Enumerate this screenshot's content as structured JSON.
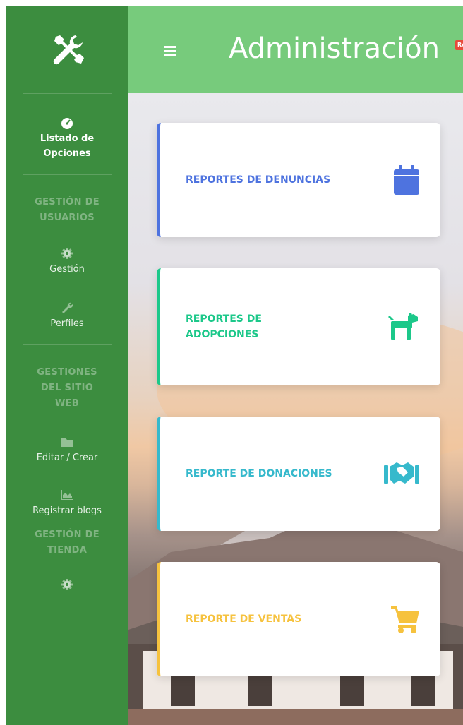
{
  "header": {
    "title": "Administración",
    "badge": "Rep"
  },
  "sidebar": {
    "items": [
      {
        "type": "item",
        "label_line1": "Listado de",
        "label_line2": "Opciones",
        "icon": "tachometer-icon",
        "active": true
      },
      {
        "type": "section",
        "line1": "GESTIÓN DE",
        "line2": "USUARIOS"
      },
      {
        "type": "item",
        "label": "Gestión",
        "icon": "gear-icon"
      },
      {
        "type": "item",
        "label": "Perfiles",
        "icon": "wrench-icon"
      },
      {
        "type": "section",
        "line1": "GESTIONES",
        "line2": "DEL SITIO",
        "line3": "WEB"
      },
      {
        "type": "item",
        "label": "Editar / Crear",
        "icon": "folder-icon"
      },
      {
        "type": "item",
        "label": "Registrar blogs",
        "icon": "area-chart-icon"
      },
      {
        "type": "section",
        "line1": "GESTIÓN DE",
        "line2": "TIENDA"
      }
    ]
  },
  "cards": [
    {
      "label": "REPORTES DE DENUNCIAS",
      "icon": "calendar-icon",
      "color": "#4e73df"
    },
    {
      "label_line1": "REPORTES DE",
      "label_line2": "ADOPCIONES",
      "icon": "dog-icon",
      "color": "#1cc88a"
    },
    {
      "label": "REPORTE DE DONACIONES",
      "icon": "handshake-icon",
      "color": "#36b9cc"
    },
    {
      "label": "REPORTE DE VENTAS",
      "icon": "shopping-cart-icon",
      "color": "#f6c23e"
    }
  ],
  "colors": {
    "sidebar": "#3c8d3f",
    "topbar": "#77cb7c"
  }
}
